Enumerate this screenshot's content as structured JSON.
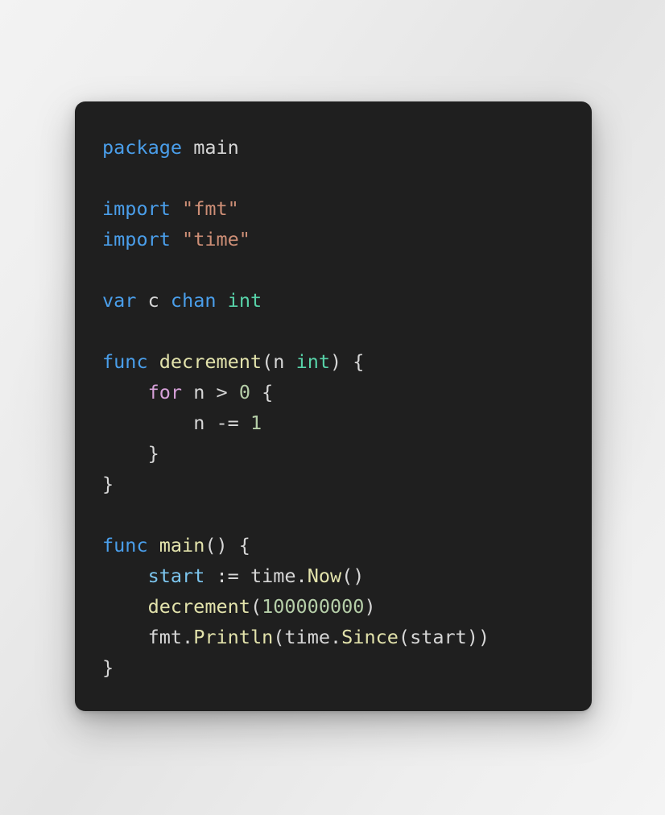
{
  "window": {
    "background_top_color": "#f3f3f3",
    "background_bottom_color": "#e4e4e4"
  },
  "code_card": {
    "background_color": "#1f1f1f",
    "corner_radius_px": 13,
    "language": "go",
    "theme_colors": {
      "keyword": "#4a9eea",
      "keyword_control": "#d6a0d8",
      "string": "#cd8e76",
      "type": "#57d2a8",
      "function": "#e2e2ab",
      "number": "#b5cea8",
      "variable": "#7cc5ee",
      "plain": "#d6d6d6"
    },
    "plain_text": "package main\n\nimport \"fmt\"\nimport \"time\"\n\nvar c chan int\n\nfunc decrement(n int) {\n    for n > 0 {\n        n -= 1\n    }\n}\n\nfunc main() {\n    start := time.Now()\n    decrement(100000000)\n    fmt.Println(time.Since(start))\n}",
    "lines": [
      {
        "id": "line-1",
        "tokens": [
          {
            "t": "package",
            "c": "kw"
          },
          {
            "t": " ",
            "c": "plain"
          },
          {
            "t": "main",
            "c": "plain"
          }
        ]
      },
      {
        "id": "line-2",
        "tokens": []
      },
      {
        "id": "line-3",
        "tokens": [
          {
            "t": "import",
            "c": "kw"
          },
          {
            "t": " ",
            "c": "plain"
          },
          {
            "t": "\"fmt\"",
            "c": "str"
          }
        ]
      },
      {
        "id": "line-4",
        "tokens": [
          {
            "t": "import",
            "c": "kw"
          },
          {
            "t": " ",
            "c": "plain"
          },
          {
            "t": "\"time\"",
            "c": "str"
          }
        ]
      },
      {
        "id": "line-5",
        "tokens": []
      },
      {
        "id": "line-6",
        "tokens": [
          {
            "t": "var",
            "c": "kw"
          },
          {
            "t": " ",
            "c": "plain"
          },
          {
            "t": "c",
            "c": "plain"
          },
          {
            "t": " ",
            "c": "plain"
          },
          {
            "t": "chan",
            "c": "kw"
          },
          {
            "t": " ",
            "c": "plain"
          },
          {
            "t": "int",
            "c": "type"
          }
        ]
      },
      {
        "id": "line-7",
        "tokens": []
      },
      {
        "id": "line-8",
        "tokens": [
          {
            "t": "func",
            "c": "kw"
          },
          {
            "t": " ",
            "c": "plain"
          },
          {
            "t": "decrement",
            "c": "func"
          },
          {
            "t": "(",
            "c": "punct"
          },
          {
            "t": "n",
            "c": "plain"
          },
          {
            "t": " ",
            "c": "plain"
          },
          {
            "t": "int",
            "c": "type"
          },
          {
            "t": ") {",
            "c": "punct"
          }
        ]
      },
      {
        "id": "line-9",
        "tokens": [
          {
            "t": "    ",
            "c": "plain"
          },
          {
            "t": "for",
            "c": "kw2"
          },
          {
            "t": " ",
            "c": "plain"
          },
          {
            "t": "n",
            "c": "plain"
          },
          {
            "t": " > ",
            "c": "punct"
          },
          {
            "t": "0",
            "c": "num"
          },
          {
            "t": " {",
            "c": "punct"
          }
        ]
      },
      {
        "id": "line-10",
        "tokens": [
          {
            "t": "        ",
            "c": "plain"
          },
          {
            "t": "n",
            "c": "plain"
          },
          {
            "t": " -= ",
            "c": "punct"
          },
          {
            "t": "1",
            "c": "num"
          }
        ]
      },
      {
        "id": "line-11",
        "tokens": [
          {
            "t": "    ",
            "c": "plain"
          },
          {
            "t": "}",
            "c": "punct"
          }
        ]
      },
      {
        "id": "line-12",
        "tokens": [
          {
            "t": "}",
            "c": "punct"
          }
        ]
      },
      {
        "id": "line-13",
        "tokens": []
      },
      {
        "id": "line-14",
        "tokens": [
          {
            "t": "func",
            "c": "kw"
          },
          {
            "t": " ",
            "c": "plain"
          },
          {
            "t": "main",
            "c": "func"
          },
          {
            "t": "() {",
            "c": "punct"
          }
        ]
      },
      {
        "id": "line-15",
        "tokens": [
          {
            "t": "    ",
            "c": "plain"
          },
          {
            "t": "start",
            "c": "var"
          },
          {
            "t": " := ",
            "c": "punct"
          },
          {
            "t": "time",
            "c": "plain"
          },
          {
            "t": ".",
            "c": "punct"
          },
          {
            "t": "Now",
            "c": "func"
          },
          {
            "t": "()",
            "c": "punct"
          }
        ]
      },
      {
        "id": "line-16",
        "tokens": [
          {
            "t": "    ",
            "c": "plain"
          },
          {
            "t": "decrement",
            "c": "func"
          },
          {
            "t": "(",
            "c": "punct"
          },
          {
            "t": "100000000",
            "c": "num"
          },
          {
            "t": ")",
            "c": "punct"
          }
        ]
      },
      {
        "id": "line-17",
        "tokens": [
          {
            "t": "    ",
            "c": "plain"
          },
          {
            "t": "fmt",
            "c": "plain"
          },
          {
            "t": ".",
            "c": "punct"
          },
          {
            "t": "Println",
            "c": "func"
          },
          {
            "t": "(",
            "c": "punct"
          },
          {
            "t": "time",
            "c": "plain"
          },
          {
            "t": ".",
            "c": "punct"
          },
          {
            "t": "Since",
            "c": "func"
          },
          {
            "t": "(",
            "c": "punct"
          },
          {
            "t": "start",
            "c": "plain"
          },
          {
            "t": "))",
            "c": "punct"
          }
        ]
      },
      {
        "id": "line-18",
        "tokens": [
          {
            "t": "}",
            "c": "punct"
          }
        ]
      }
    ]
  }
}
